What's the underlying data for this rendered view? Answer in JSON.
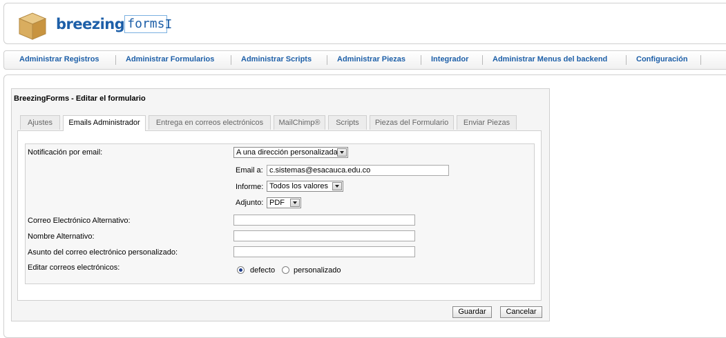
{
  "logo": {
    "brand_bold": "breezing",
    "brand_light": "forms",
    "cursor": "I"
  },
  "nav": {
    "items": [
      {
        "label": "Administrar Registros"
      },
      {
        "label": "Administrar Formularios"
      },
      {
        "label": "Administrar Scripts"
      },
      {
        "label": "Administrar Piezas"
      },
      {
        "label": "Integrador"
      },
      {
        "label": "Administrar Menus del backend"
      },
      {
        "label": "Configuración"
      }
    ]
  },
  "editor": {
    "title": "BreezingForms - Editar el formulario",
    "tabs": [
      {
        "label": "Ajustes"
      },
      {
        "label": "Emails Administrador"
      },
      {
        "label": "Entrega en correos electrónicos"
      },
      {
        "label": "MailChimp®"
      },
      {
        "label": "Scripts"
      },
      {
        "label": "Piezas del Formulario"
      },
      {
        "label": "Enviar Piezas"
      }
    ],
    "active_tab": "Emails Administrador"
  },
  "form": {
    "notificacion_label": "Notificación por email:",
    "notificacion_value": "A una dirección personalizada",
    "email_label": "Email a:",
    "email_value": "c.sistemas@esacauca.edu.co",
    "informe_label": "Informe:",
    "informe_value": "Todos los valores",
    "adjunto_label": "Adjunto:",
    "adjunto_value": "PDF",
    "correo_alt_label": "Correo Electrónico Alternativo:",
    "correo_alt_value": "",
    "nombre_alt_label": "Nombre Alternativo:",
    "nombre_alt_value": "",
    "asunto_label": "Asunto del correo electrónico personalizado:",
    "asunto_value": "",
    "editar_label": "Editar correos electrónicos:",
    "radio_defecto": "defecto",
    "radio_personalizado": "personalizado",
    "selected_radio": "defecto"
  },
  "buttons": {
    "guardar": "Guardar",
    "cancelar": "Cancelar"
  },
  "colors": {
    "link_blue": "#1d5fa8",
    "border": "#cfcfcf"
  }
}
